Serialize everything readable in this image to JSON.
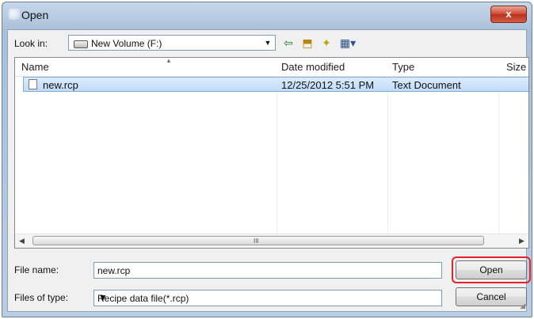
{
  "window": {
    "title": "Open",
    "close_glyph": "x"
  },
  "look_in": {
    "label": "Look in:",
    "value": "New Volume (F:)",
    "drive_icon": "drive-icon"
  },
  "toolbar": {
    "back_icon": "back-arrow-icon",
    "up_icon": "up-folder-icon",
    "new_folder_icon": "new-folder-icon",
    "views_icon": "views-menu-icon"
  },
  "list": {
    "columns": [
      "Name",
      "Date modified",
      "Type",
      "Size"
    ],
    "rows": [
      {
        "name": "new.rcp",
        "date": "12/25/2012 5:51 PM",
        "type": "Text Document",
        "size": ""
      }
    ]
  },
  "scrollbar": {
    "grip": "III"
  },
  "file_name": {
    "label": "File name:",
    "value": "new.rcp"
  },
  "file_type": {
    "label": "Files of type:",
    "value": "Recipe data file(*.rcp)"
  },
  "buttons": {
    "open": "Open",
    "cancel": "Cancel"
  },
  "colors": {
    "highlight": "#e3222b",
    "selection": "#c1dcf8",
    "title_bar": "#a9c0d9"
  }
}
